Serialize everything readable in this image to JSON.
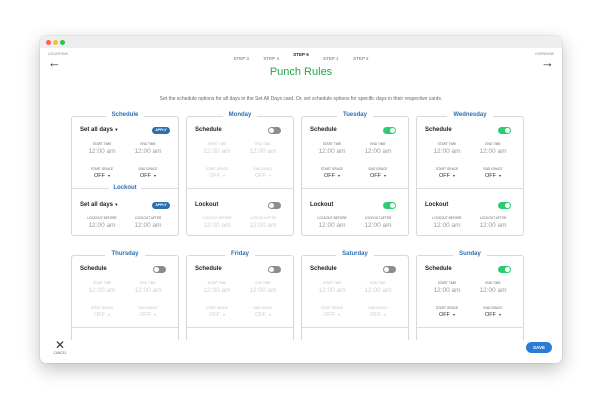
{
  "nav": {
    "back_label": "LOCATIONS",
    "back_icon": "arrow-left-icon",
    "next_label": "OVERVIEW",
    "next_icon": "arrow-right-icon",
    "cancel_label": "CANCEL",
    "cancel_icon": "close-icon",
    "save_label": "SAVE"
  },
  "steps": [
    "STEP 3",
    "STEP 4",
    "STEP 5",
    "STEP 1",
    "STEP 2"
  ],
  "active_step_index": 2,
  "title": "Punch Rules",
  "subtitle": "Set the schedule options for all days in the Set All Days card. Or, set schedule options for specific days in their respective cards.",
  "labels": {
    "schedule": "Schedule",
    "lockout": "Lockout",
    "set_all_days": "Set all days",
    "apply": "APPLY",
    "start_time": "START TIME",
    "end_time": "END TIME",
    "start_grace": "START GRACE",
    "end_grace": "END GRACE",
    "lockout_before": "LOCKOUT BEFORE",
    "lockout_after": "LOCKOUT AFTER",
    "time_value": "12:00 am",
    "off_value": "OFF"
  },
  "cards": {
    "all": {
      "heading": "Schedule",
      "lockout_heading": "Lockout"
    },
    "monday": {
      "heading": "Monday",
      "schedule_on": false,
      "lockout_on": false
    },
    "tuesday": {
      "heading": "Tuesday",
      "schedule_on": true,
      "lockout_on": true
    },
    "wednesday": {
      "heading": "Wednesday",
      "schedule_on": true,
      "lockout_on": true
    },
    "thursday": {
      "heading": "Thursday",
      "schedule_on": false
    },
    "friday": {
      "heading": "Friday",
      "schedule_on": false
    },
    "saturday": {
      "heading": "Saturday",
      "schedule_on": false
    },
    "sunday": {
      "heading": "Sunday",
      "schedule_on": true
    }
  },
  "colors": {
    "accent": "#2a6fb0",
    "title_green": "#22a84a",
    "toggle_on": "#2ecc71",
    "toggle_off": "#8c8c8c"
  }
}
